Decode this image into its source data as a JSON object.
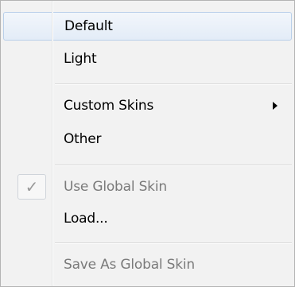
{
  "menu": {
    "items": [
      {
        "label": "Default",
        "state": "highlighted"
      },
      {
        "label": "Light"
      },
      {
        "label": "Custom Skins",
        "submenu": true
      },
      {
        "label": "Other"
      },
      {
        "label": "Use Global Skin",
        "checked": true,
        "disabled": true
      },
      {
        "label": "Load..."
      },
      {
        "label": "Save As Global Skin",
        "disabled": true
      }
    ],
    "check_glyph": "✓",
    "icons": {
      "check": "check-icon",
      "submenu_arrow": "chevron-right-icon"
    },
    "colors": {
      "highlight_border": "#b9cfe9",
      "disabled_text": "#7a7a7a",
      "background": "#f2f2f2"
    }
  }
}
